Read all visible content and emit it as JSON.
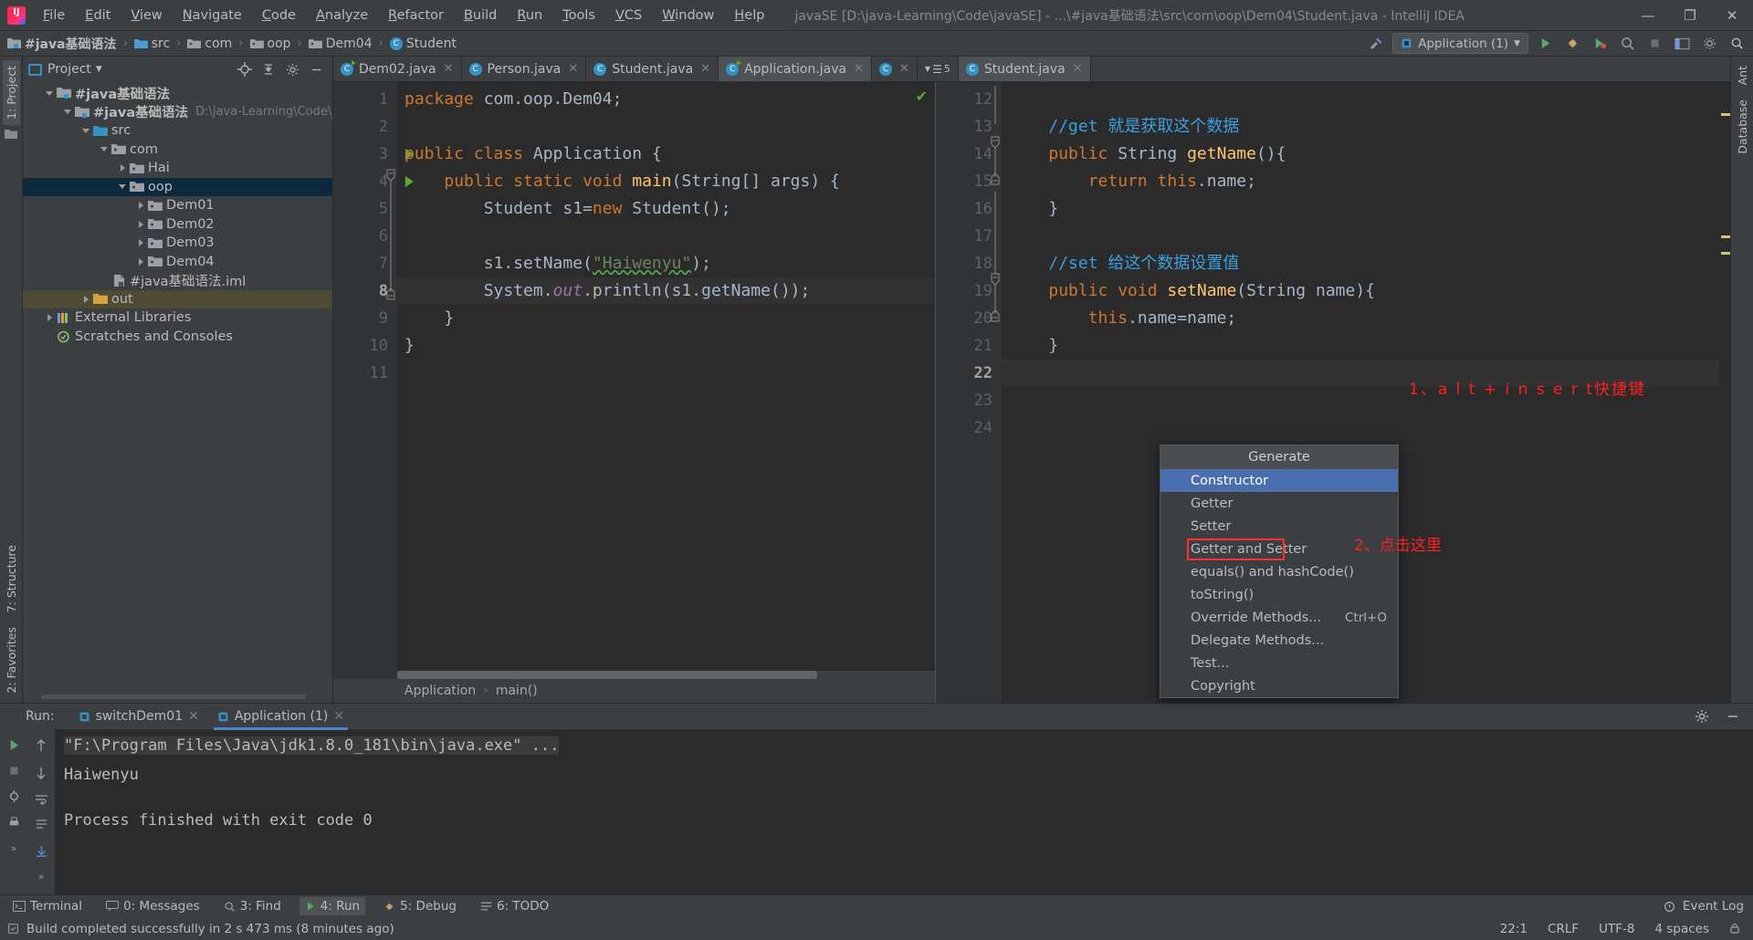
{
  "titlebar": {
    "menus": [
      "File",
      "Edit",
      "View",
      "Navigate",
      "Code",
      "Analyze",
      "Refactor",
      "Build",
      "Run",
      "Tools",
      "VCS",
      "Window",
      "Help"
    ],
    "project_path": "javaSE [D:\\java-Learning\\Code\\javaSE] - ...\\#java基础语法\\src\\com\\oop\\Dem04\\Student.java - IntelliJ IDEA",
    "minimize": "—",
    "maximize": "❐",
    "close": "✕"
  },
  "navbar": {
    "crumbs": [
      "#java基础语法",
      "src",
      "com",
      "oop",
      "Dem04",
      "Student"
    ],
    "run_config": "Application (1)",
    "icons": [
      "hammer-icon",
      "run-icon",
      "debug-icon",
      "coverage-icon",
      "profile-icon",
      "stop-icon",
      "layout-icon",
      "settings-icon",
      "search-icon"
    ]
  },
  "left_rail": {
    "top": "1: Project",
    "bottom": [
      "2: Favorites",
      "7: Structure"
    ]
  },
  "project_panel": {
    "title": "Project",
    "tree": [
      {
        "label": "#java基础语法",
        "indent": 0,
        "twisty": "down",
        "icon": "module-icon",
        "bold": true,
        "sub": ""
      },
      {
        "label": "#java基础语法",
        "indent": 1,
        "twisty": "down",
        "icon": "module-icon",
        "bold": true,
        "sub": "D:\\java-Learning\\Code\\javaSE\\#ja"
      },
      {
        "label": "src",
        "indent": 2,
        "twisty": "down",
        "icon": "src-folder-icon",
        "bold": false,
        "sub": ""
      },
      {
        "label": "com",
        "indent": 3,
        "twisty": "down",
        "icon": "package-icon",
        "bold": false,
        "sub": ""
      },
      {
        "label": "Hai",
        "indent": 4,
        "twisty": "right",
        "icon": "package-icon",
        "bold": false,
        "sub": ""
      },
      {
        "label": "oop",
        "indent": 4,
        "twisty": "down",
        "icon": "package-icon",
        "bold": false,
        "sub": "",
        "selected": true
      },
      {
        "label": "Dem01",
        "indent": 5,
        "twisty": "right",
        "icon": "package-icon",
        "bold": false,
        "sub": ""
      },
      {
        "label": "Dem02",
        "indent": 5,
        "twisty": "right",
        "icon": "package-icon",
        "bold": false,
        "sub": ""
      },
      {
        "label": "Dem03",
        "indent": 5,
        "twisty": "right",
        "icon": "package-icon",
        "bold": false,
        "sub": ""
      },
      {
        "label": "Dem04",
        "indent": 5,
        "twisty": "right",
        "icon": "package-icon",
        "bold": false,
        "sub": ""
      },
      {
        "label": "#java基础语法.iml",
        "indent": 3,
        "twisty": "none",
        "icon": "iml-file-icon",
        "bold": false,
        "sub": ""
      },
      {
        "label": "out",
        "indent": 2,
        "twisty": "right",
        "icon": "out-folder-icon",
        "bold": false,
        "sub": "",
        "highlight": true
      },
      {
        "label": "External Libraries",
        "indent": 0,
        "twisty": "right",
        "icon": "library-icon",
        "bold": false,
        "sub": ""
      },
      {
        "label": "Scratches and Consoles",
        "indent": 0,
        "twisty": "none",
        "icon": "scratch-icon",
        "bold": false,
        "sub": ""
      }
    ]
  },
  "editor": {
    "tabs": [
      {
        "label": "Dem02.java",
        "active": false,
        "run": true
      },
      {
        "label": "Person.java",
        "active": false,
        "run": false
      },
      {
        "label": "Student.java",
        "active": false,
        "run": false
      },
      {
        "label": "Application.java",
        "active": true,
        "run": true
      }
    ],
    "split_tab_badge": "5",
    "right_tab": {
      "label": "Student.java",
      "active": true
    },
    "left_pane": {
      "first_line": 1,
      "lines": [
        {
          "n": 1,
          "html": "<span class=\"kw\">package</span> com.oop.Dem04;",
          "run": false,
          "cur": false
        },
        {
          "n": 2,
          "html": "",
          "run": false,
          "cur": false
        },
        {
          "n": 3,
          "html": "<span class=\"kw\">public class</span> Application {",
          "run": true,
          "cur": false
        },
        {
          "n": 4,
          "html": "    <span class=\"kw\">public static void</span> <span class=\"fn\">main</span>(String[] args) {",
          "run": true,
          "cur": false
        },
        {
          "n": 5,
          "html": "        Student s1=<span class=\"kw\">new</span> Student();",
          "run": false,
          "cur": false
        },
        {
          "n": 6,
          "html": "",
          "run": false,
          "cur": false
        },
        {
          "n": 7,
          "html": "        s1.setName(<span class=\"str wavy\">\"Haiwenyu\"</span>);",
          "run": false,
          "cur": false
        },
        {
          "n": 8,
          "html": "        System.<span class=\"st\">out</span>.println(s1.getName());",
          "run": false,
          "cur": true
        },
        {
          "n": 9,
          "html": "    }",
          "run": false,
          "cur": false
        },
        {
          "n": 10,
          "html": "}",
          "run": false,
          "cur": false
        },
        {
          "n": 11,
          "html": "",
          "run": false,
          "cur": false
        }
      ],
      "breadcrumb": [
        "Application",
        "main()"
      ]
    },
    "right_pane": {
      "lines": [
        {
          "n": 12,
          "html": "",
          "fold": "none"
        },
        {
          "n": 13,
          "html": "    <span class=\"cmt2\">//get 就是获取这个数据</span>",
          "fold": "none"
        },
        {
          "n": 14,
          "html": "    <span class=\"kw\">public</span> String <span class=\"fn\">getName</span>(){",
          "fold": "down"
        },
        {
          "n": 15,
          "html": "        <span class=\"kw\">return this</span>.name;",
          "fold": "bar"
        },
        {
          "n": 16,
          "html": "    }",
          "fold": "up"
        },
        {
          "n": 17,
          "html": "",
          "fold": "none"
        },
        {
          "n": 18,
          "html": "    <span class=\"cmt2\">//set 给这个数据设置值</span>",
          "fold": "none"
        },
        {
          "n": 19,
          "html": "    <span class=\"kw\">public void</span> <span class=\"fn\">setName</span>(String name){",
          "fold": "down"
        },
        {
          "n": 20,
          "html": "        <span class=\"kw\">this</span>.name=name;",
          "fold": "bar"
        },
        {
          "n": 21,
          "html": "    }",
          "fold": "up"
        },
        {
          "n": 22,
          "html": "",
          "fold": "none"
        },
        {
          "n": 23,
          "html": "",
          "fold": "none"
        },
        {
          "n": 24,
          "html": "",
          "fold": "none"
        }
      ],
      "current_line": 22
    }
  },
  "generate_popup": {
    "title": "Generate",
    "items": [
      {
        "label": "Constructor",
        "shortcut": "",
        "selected": true,
        "boxed": false
      },
      {
        "label": "Getter",
        "shortcut": "",
        "selected": false,
        "boxed": false
      },
      {
        "label": "Setter",
        "shortcut": "",
        "selected": false,
        "boxed": false
      },
      {
        "label": "Getter and Setter",
        "shortcut": "",
        "selected": false,
        "boxed": true
      },
      {
        "label": "equals() and hashCode()",
        "shortcut": "",
        "selected": false,
        "boxed": false
      },
      {
        "label": "toString()",
        "shortcut": "",
        "selected": false,
        "boxed": false
      },
      {
        "label": "Override Methods...",
        "shortcut": "Ctrl+O",
        "selected": false,
        "boxed": false
      },
      {
        "label": "Delegate Methods...",
        "shortcut": "",
        "selected": false,
        "boxed": false
      },
      {
        "label": "Test...",
        "shortcut": "",
        "selected": false,
        "boxed": false
      },
      {
        "label": "Copyright",
        "shortcut": "",
        "selected": false,
        "boxed": false
      }
    ]
  },
  "annotations": {
    "one": "1、a l t + i n s e r t快捷键",
    "two": "2、点击这里",
    "color": "#ff2020"
  },
  "run_window": {
    "label": "Run:",
    "tabs": [
      {
        "label": "switchDem01",
        "active": false
      },
      {
        "label": "Application (1)",
        "active": true
      }
    ],
    "console": [
      "\"F:\\Program Files\\Java\\jdk1.8.0_181\\bin\\java.exe\" ...",
      "Haiwenyu",
      "Process finished with exit code 0"
    ]
  },
  "bottom_toolbar": {
    "items": [
      {
        "label": "Terminal",
        "icon": "terminal-icon",
        "active": false
      },
      {
        "label": "0: Messages",
        "icon": "messages-icon",
        "active": false
      },
      {
        "label": "3: Find",
        "icon": "find-icon",
        "active": false
      },
      {
        "label": "4: Run",
        "icon": "run-icon",
        "active": true
      },
      {
        "label": "5: Debug",
        "icon": "debug-icon",
        "active": false
      },
      {
        "label": "6: TODO",
        "icon": "todo-icon",
        "active": false
      }
    ],
    "event_log": "Event Log"
  },
  "statusbar": {
    "message": "Build completed successfully in 2 s 473 ms (8 minutes ago)",
    "caret": "22:1",
    "line_sep": "CRLF",
    "encoding": "UTF-8",
    "indent": "4 spaces"
  },
  "right_rail": {
    "items": [
      "Ant",
      "Database"
    ]
  },
  "colors": {
    "accent": "#4b6eaf",
    "annotation_red": "#ff2020",
    "selection_blue": "#0d293e",
    "run_green": "#5fa832",
    "panel_bg": "#3c3f41",
    "editor_bg": "#2b2b2b"
  }
}
